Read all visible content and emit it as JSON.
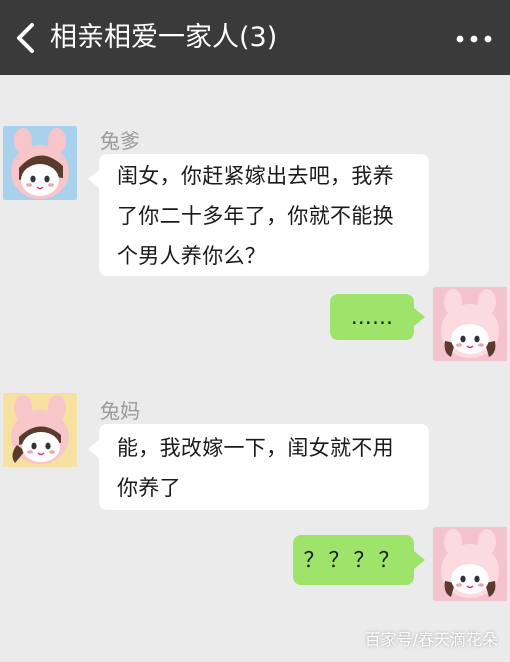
{
  "header": {
    "title": "相亲相爱一家人(3)",
    "back_icon": "chevron-left-icon",
    "more_icon": "ellipsis-icon"
  },
  "messages": [
    {
      "sender": "兔爹",
      "side": "left",
      "lines": [
        "闺女，你赶紧嫁出去吧，我养",
        "了你二十多年了，你就不能换",
        "个男人养你么？"
      ]
    },
    {
      "sender": "",
      "side": "right",
      "lines": [
        "……"
      ]
    },
    {
      "sender": "兔妈",
      "side": "left",
      "lines": [
        "能，我改嫁一下，闺女就不用",
        "你养了"
      ]
    },
    {
      "sender": "",
      "side": "right",
      "lines": [
        "？？？？"
      ]
    }
  ],
  "watermark": "百家号/春天滴花朵",
  "colors": {
    "header_bg": "#3a3a3a",
    "chat_bg": "#ebebeb",
    "bubble_self": "#9ee36a",
    "bubble_other": "#ffffff"
  }
}
